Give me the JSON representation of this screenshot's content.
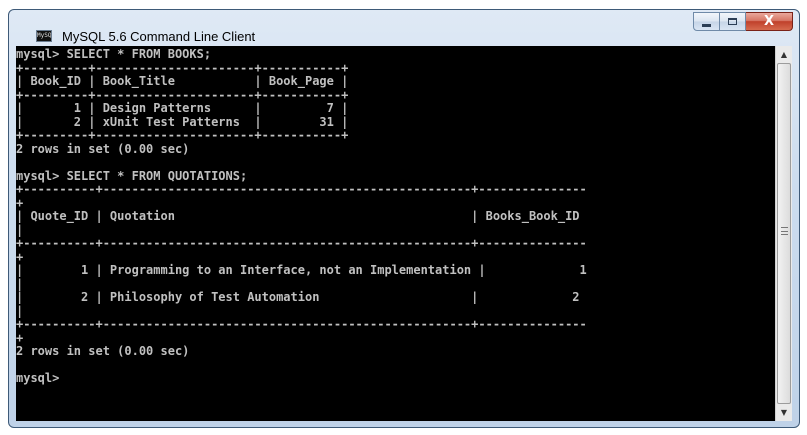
{
  "window": {
    "title": "MySQL 5.6 Command Line Client",
    "icon_label": "MySQL",
    "buttons": {
      "minimize_icon": "minimize-icon",
      "maximize_icon": "maximize-icon",
      "close_glyph": "X"
    }
  },
  "console": {
    "lines": [
      "mysql> SELECT * FROM BOOKS;",
      "+---------+----------------------+-----------+",
      "| Book_ID | Book_Title           | Book_Page |",
      "+---------+----------------------+-----------+",
      "|       1 | Design Patterns      |         7 |",
      "|       2 | xUnit Test Patterns  |        31 |",
      "+---------+----------------------+-----------+",
      "2 rows in set (0.00 sec)",
      "",
      "mysql> SELECT * FROM QUOTATIONS;",
      "+----------+---------------------------------------------------+---------------",
      "+",
      "| Quote_ID | Quotation                                         | Books_Book_ID",
      "|",
      "+----------+---------------------------------------------------+---------------",
      "+",
      "|        1 | Programming to an Interface, not an Implementation |             1",
      "|",
      "|        2 | Philosophy of Test Automation                     |             2",
      "|",
      "+----------+---------------------------------------------------+---------------",
      "+",
      "2 rows in set (0.00 sec)",
      "",
      "mysql>"
    ]
  },
  "scrollbar": {
    "up_icon": "scroll-up-icon",
    "down_icon": "scroll-down-icon"
  },
  "colors": {
    "console_bg": "#000000",
    "console_text": "#c0c0c0",
    "close_button": "#c0402b"
  }
}
